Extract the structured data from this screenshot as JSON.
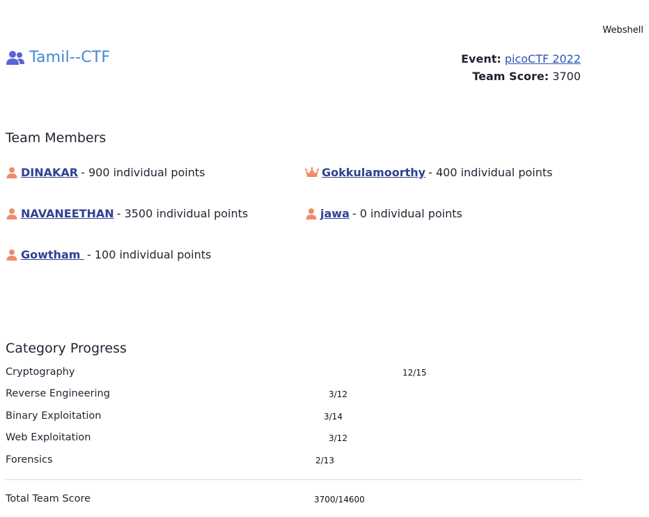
{
  "header": {
    "webshell_label": "Webshell",
    "team_name": "Tamil--CTF",
    "event_label": "Event:",
    "event_name": "picoCTF 2022",
    "score_label": "Team Score:",
    "score_value": "3700"
  },
  "members_section": {
    "title": "Team Members",
    "members": [
      {
        "name": "DINAKAR",
        "points": "- 900 individual points",
        "icon": "user-icon"
      },
      {
        "name": "Gokkulamoorthy",
        "points": "- 400 individual points",
        "icon": "crown-icon"
      },
      {
        "name": "NAVANEETHAN",
        "points": "- 3500 individual points",
        "icon": "user-icon"
      },
      {
        "name": "jawa",
        "points": "- 0 individual points",
        "icon": "user-icon"
      },
      {
        "name": "Gowtham ",
        "points": "- 100 individual points",
        "icon": "user-icon"
      }
    ]
  },
  "progress_section": {
    "title": "Category Progress",
    "categories": [
      {
        "label": "Cryptography",
        "value": "12/15"
      },
      {
        "label": "Reverse Engineering",
        "value": "3/12"
      },
      {
        "label": "Binary Exploitation",
        "value": "3/14"
      },
      {
        "label": "Web Exploitation",
        "value": "3/12"
      },
      {
        "label": "Forensics",
        "value": "2/13"
      }
    ],
    "total_label": "Total Team Score",
    "total_value": "3700/14600"
  },
  "colors": {
    "accent_blue": "#3f88d4",
    "team_icon": "#5b63d6",
    "member_icon": "#f08a6a",
    "link": "#2f4192"
  }
}
